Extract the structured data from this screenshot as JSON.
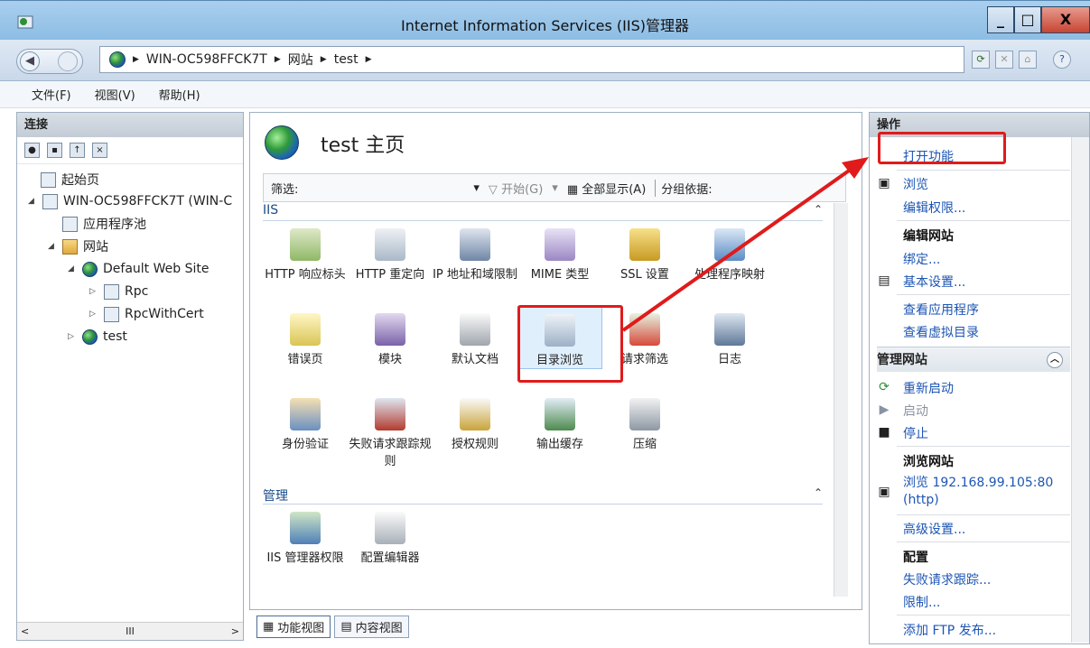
{
  "window": {
    "title": "Internet Information Services (IIS)管理器",
    "min": "_",
    "max": "□",
    "close": "X"
  },
  "address": {
    "crumbs": [
      "WIN-OC598FFCK7T",
      "网站",
      "test"
    ]
  },
  "menu": [
    "文件(F)",
    "视图(V)",
    "帮助(H)"
  ],
  "left": {
    "header": "连接",
    "tree": [
      {
        "label": "起始页"
      },
      {
        "label": "WIN-OC598FFCK7T (WIN-C"
      },
      {
        "label": "应用程序池"
      },
      {
        "label": "网站"
      },
      {
        "label": "Default Web Site"
      },
      {
        "label": "Rpc"
      },
      {
        "label": "RpcWithCert"
      },
      {
        "label": "test"
      }
    ],
    "scroll_mid": "III"
  },
  "center": {
    "title": "test 主页",
    "filter_label": "筛选:",
    "filter_start": "开始(G)",
    "filter_showall": "全部显示(A)",
    "filter_group": "分组依据:",
    "groups": [
      {
        "name": "IIS"
      },
      {
        "name": "管理"
      }
    ],
    "features": [
      "HTTP 响应标头",
      "HTTP 重定向",
      "IP 地址和域限制",
      "MIME 类型",
      "SSL 设置",
      "处理程序映射",
      "错误页",
      "模块",
      "默认文档",
      "目录浏览",
      "请求筛选",
      "日志",
      "身份验证",
      "失败请求跟踪规则",
      "授权规则",
      "输出缓存",
      "压缩",
      "IIS 管理器权限",
      "配置编辑器"
    ],
    "tabs": [
      "功能视图",
      "内容视图"
    ]
  },
  "right": {
    "header": "操作",
    "open_feature": "打开功能",
    "browse": "浏览",
    "edit_perm": "编辑权限...",
    "edit_site_h": "编辑网站",
    "bind": "绑定...",
    "basic": "基本设置...",
    "view_apps": "查看应用程序",
    "view_vdirs": "查看虚拟目录",
    "manage_h": "管理网站",
    "restart": "重新启动",
    "start": "启动",
    "stop": "停止",
    "browse_site_h": "浏览网站",
    "browse_addr": "浏览 192.168.99.105:80",
    "browse_proto": "(http)",
    "advanced": "高级设置...",
    "config_h": "配置",
    "failed_trace": "失败请求跟踪...",
    "limits": "限制...",
    "add_ftp": "添加 FTP 发布..."
  },
  "colors": {
    "accent_link": "#1d55b3",
    "highlight_red": "#e01b1b"
  }
}
